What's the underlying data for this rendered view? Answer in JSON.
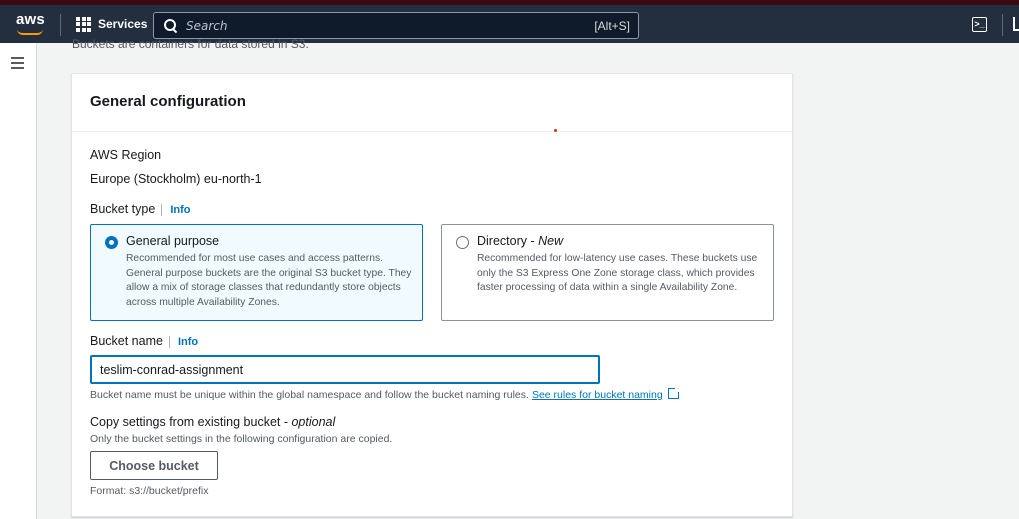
{
  "nav": {
    "logo": "aws",
    "services_label": "Services",
    "search_placeholder": "Search",
    "search_shortcut": "[Alt+S]"
  },
  "page": {
    "cut_description": "Buckets are containers for data stored in S3."
  },
  "panel": {
    "title": "General configuration",
    "region_label": "AWS Region",
    "region_value": "Europe (Stockholm) eu-north-1",
    "bucket_type_label": "Bucket type",
    "info_label": "Info",
    "options": [
      {
        "title": "General purpose",
        "title_suffix": "",
        "desc": "Recommended for most use cases and access patterns. General purpose buckets are the original S3 bucket type. They allow a mix of storage classes that redundantly store objects across multiple Availability Zones.",
        "selected": true
      },
      {
        "title": "Directory - ",
        "title_suffix": "New",
        "desc": "Recommended for low-latency use cases. These buckets use only the S3 Express One Zone storage class, which provides faster processing of data within a single Availability Zone.",
        "selected": false
      }
    ],
    "bucket_name_label": "Bucket name",
    "bucket_name_value": "teslim-conrad-assignment",
    "bucket_name_hint": "Bucket name must be unique within the global namespace and follow the bucket naming rules.",
    "bucket_naming_link": "See rules for bucket naming",
    "copy_title": "Copy settings from existing bucket - ",
    "copy_title_optional": "optional",
    "copy_desc": "Only the bucket settings in the following configuration are copied.",
    "choose_button": "Choose bucket",
    "format_hint": "Format: s3://bucket/prefix"
  },
  "colors": {
    "nav_bg": "#232f3e",
    "accent": "#0073bb",
    "selected_tile_bg": "#f1faff"
  }
}
